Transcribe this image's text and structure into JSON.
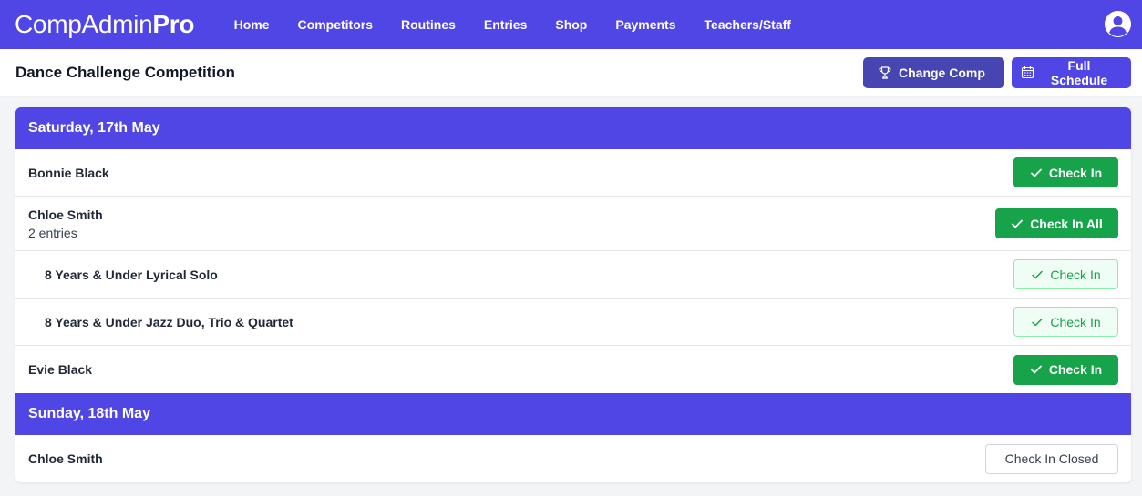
{
  "app": {
    "brand_light": "CompAdmin",
    "brand_bold": "Pro"
  },
  "nav": {
    "items": [
      {
        "label": "Home"
      },
      {
        "label": "Competitors"
      },
      {
        "label": "Routines"
      },
      {
        "label": "Entries"
      },
      {
        "label": "Shop"
      },
      {
        "label": "Payments"
      },
      {
        "label": "Teachers/Staff"
      }
    ],
    "account_icon": "user-circle-icon"
  },
  "header": {
    "title": "Dance Challenge Competition",
    "change_comp_label": "Change Comp",
    "change_comp_icon": "trophy-icon",
    "full_schedule_label": "Full Schedule",
    "full_schedule_icon": "calendar-icon"
  },
  "schedule": {
    "days": [
      {
        "date": "Saturday, 17th May",
        "competitors": [
          {
            "name": "Bonnie Black",
            "button": "Check In"
          },
          {
            "name": "Chloe Smith",
            "entries": "2 entries",
            "button": "Check In All",
            "routines": [
              {
                "name": "8 Years & Under Lyrical Solo",
                "button": "Check In"
              },
              {
                "name": "8 Years & Under Jazz Duo, Trio & Quartet",
                "button": "Check In"
              }
            ]
          },
          {
            "name": "Evie Black",
            "button": "Check In"
          }
        ]
      },
      {
        "date": "Sunday, 18th May",
        "competitors": [
          {
            "name": "Chloe Smith",
            "button": "Check In Closed"
          }
        ]
      }
    ]
  },
  "colors": {
    "primary": "#4f46e5",
    "success": "#16a34a"
  }
}
